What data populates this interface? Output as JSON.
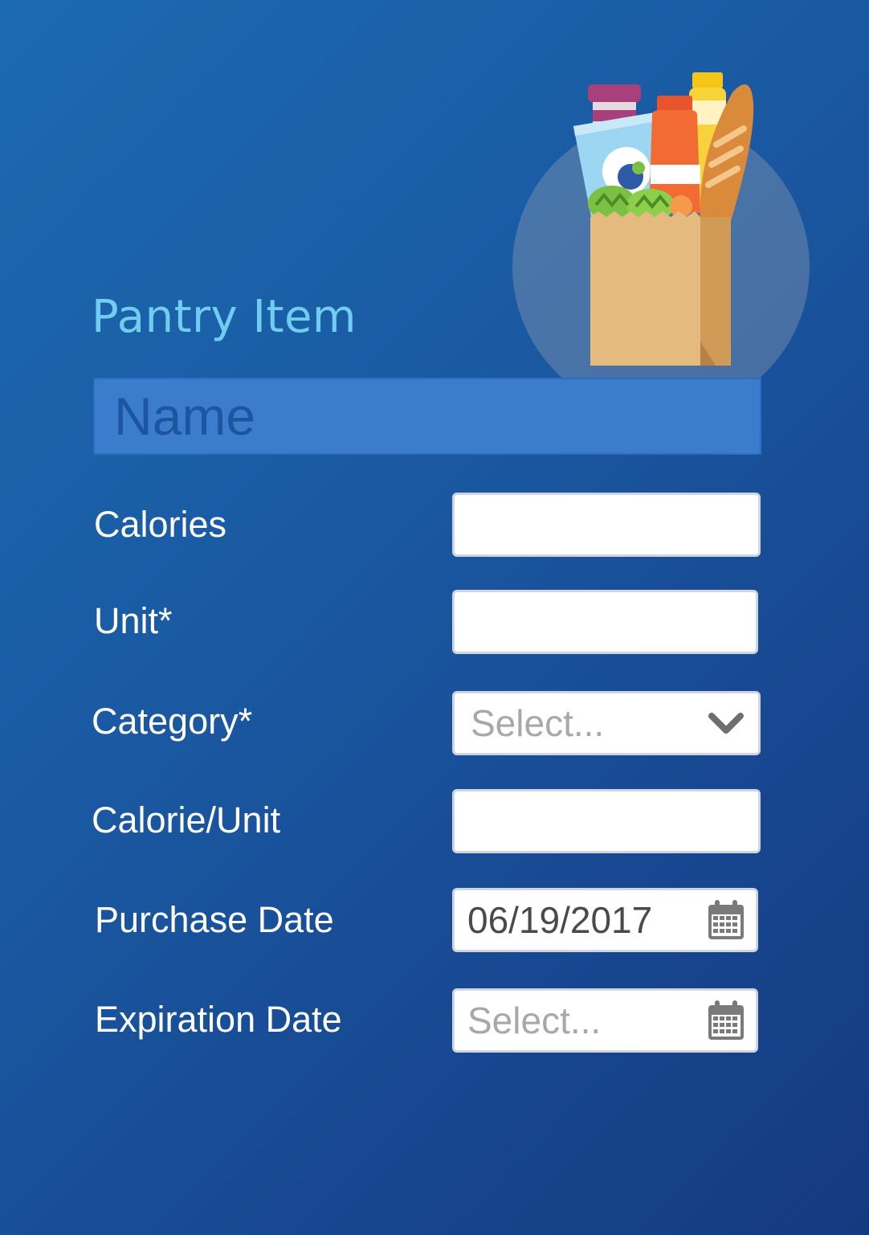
{
  "form": {
    "title": "Pantry Item",
    "name_placeholder": "Name"
  },
  "fields": {
    "calories": {
      "label": "Calories",
      "value": ""
    },
    "unit": {
      "label": "Unit*",
      "value": ""
    },
    "category": {
      "label": "Category*",
      "placeholder": "Select...",
      "icon": "chevron-down-icon"
    },
    "calorie_unit": {
      "label": "Calorie/Unit",
      "value": ""
    },
    "purchase_date": {
      "label": "Purchase Date",
      "value": "06/19/2017",
      "icon": "calendar-icon"
    },
    "expiration_date": {
      "label": "Expiration Date",
      "placeholder": "Select...",
      "icon": "calendar-icon"
    }
  },
  "colors": {
    "background_start": "#1c6ab0",
    "background_end": "#153a80",
    "title": "#6fcdef",
    "name_field": "#3b7dcc",
    "placeholder": "#a8a8a8"
  },
  "illustration": "grocery-bag-icon"
}
